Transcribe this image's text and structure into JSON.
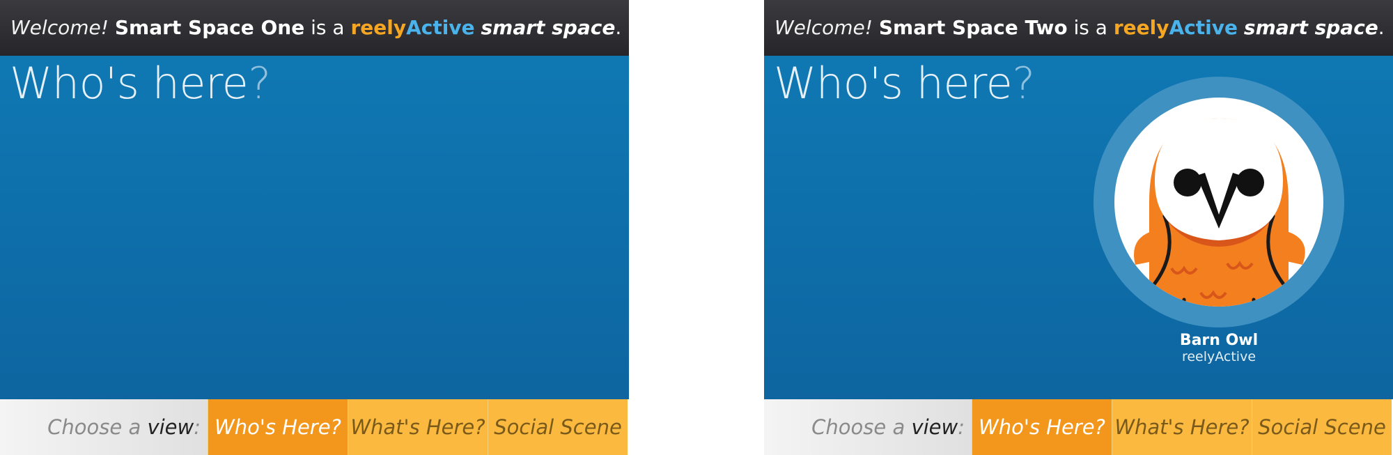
{
  "panels": [
    {
      "header": {
        "welcome": "Welcome!",
        "space_name": "Smart Space One",
        "is_a": "is a",
        "brand_reely": "reely",
        "brand_active": "Active",
        "smart_space": "smart space",
        "period": "."
      },
      "main": {
        "title": "Who's here",
        "title_qmark": "?"
      },
      "nav": {
        "choose_prefix": "Choose a",
        "choose_view": "view",
        "choose_colon": ":",
        "tabs": [
          {
            "label": "Who's Here?",
            "active": true
          },
          {
            "label": "What's Here?",
            "active": false
          },
          {
            "label": "Social Scene",
            "active": false
          }
        ]
      }
    },
    {
      "header": {
        "welcome": "Welcome!",
        "space_name": "Smart Space Two",
        "is_a": "is a",
        "brand_reely": "reely",
        "brand_active": "Active",
        "smart_space": "smart space",
        "period": "."
      },
      "main": {
        "title": "Who's here",
        "title_qmark": "?",
        "person": {
          "avatar": "barn-owl-icon",
          "name": "Barn Owl",
          "org": "reelyActive"
        }
      },
      "nav": {
        "choose_prefix": "Choose a",
        "choose_view": "view",
        "choose_colon": ":",
        "tabs": [
          {
            "label": "Who's Here?",
            "active": true
          },
          {
            "label": "What's Here?",
            "active": false
          },
          {
            "label": "Social Scene",
            "active": false
          }
        ]
      }
    }
  ],
  "colors": {
    "brand_orange": "#f5a623",
    "brand_blue": "#4ab3ec",
    "main_blue": "#0f78b3",
    "tab_active": "#f2961c",
    "tab_inactive": "#fcb940",
    "owl_orange": "#f47f1f"
  }
}
